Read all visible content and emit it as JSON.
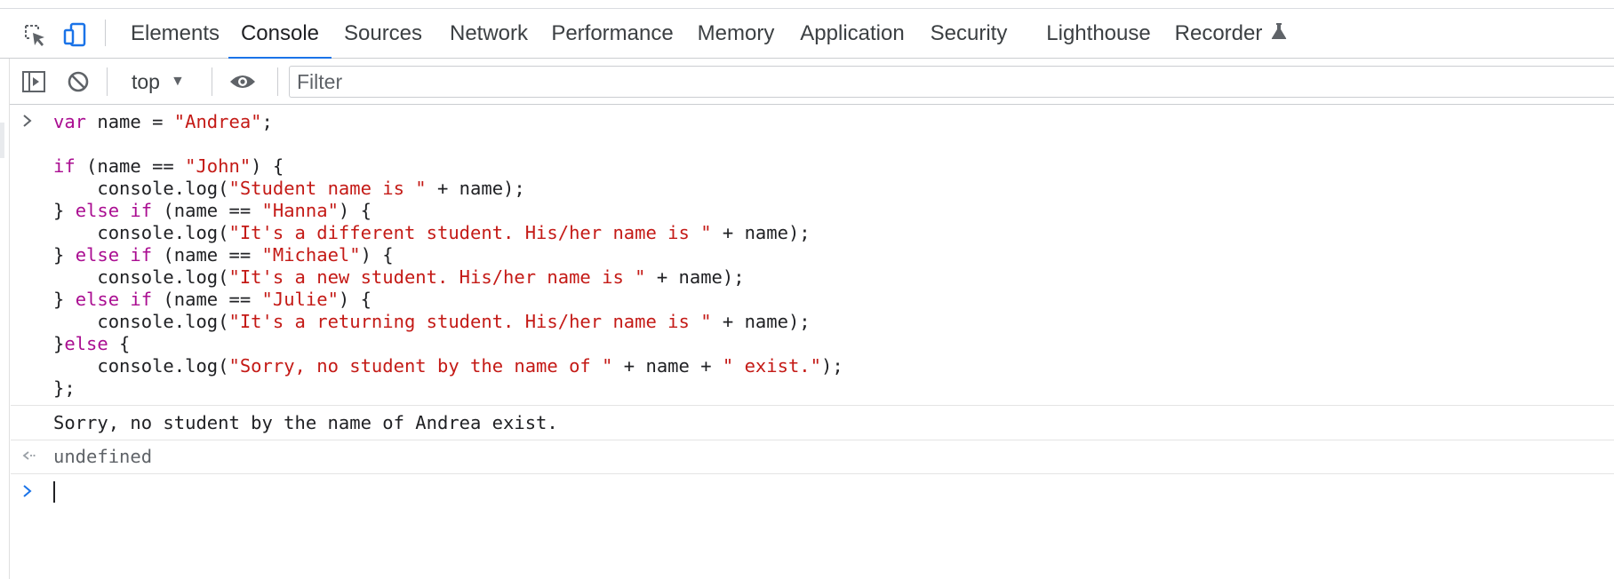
{
  "tabs": [
    "Elements",
    "Console",
    "Sources",
    "Network",
    "Performance",
    "Memory",
    "Application",
    "Security",
    "Lighthouse",
    "Recorder"
  ],
  "active_tab": "Console",
  "toolbar": {
    "context": "top",
    "filter_placeholder": "Filter"
  },
  "console": {
    "input_lines": [
      [
        {
          "t": "var",
          "c": "kw"
        },
        {
          "t": " name = "
        },
        {
          "t": "\"Andrea\"",
          "c": "str"
        },
        {
          "t": ";"
        }
      ],
      [],
      [
        {
          "t": "if",
          "c": "kw"
        },
        {
          "t": " (name == "
        },
        {
          "t": "\"John\"",
          "c": "str"
        },
        {
          "t": ") {"
        }
      ],
      [
        {
          "t": "    console.log("
        },
        {
          "t": "\"Student name is \"",
          "c": "str"
        },
        {
          "t": " + name);"
        }
      ],
      [
        {
          "t": "} "
        },
        {
          "t": "else if",
          "c": "kw"
        },
        {
          "t": " (name == "
        },
        {
          "t": "\"Hanna\"",
          "c": "str"
        },
        {
          "t": ") {"
        }
      ],
      [
        {
          "t": "    console.log("
        },
        {
          "t": "\"It's a different student. His/her name is \"",
          "c": "str"
        },
        {
          "t": " + name);"
        }
      ],
      [
        {
          "t": "} "
        },
        {
          "t": "else if",
          "c": "kw"
        },
        {
          "t": " (name == "
        },
        {
          "t": "\"Michael\"",
          "c": "str"
        },
        {
          "t": ") {"
        }
      ],
      [
        {
          "t": "    console.log("
        },
        {
          "t": "\"It's a new student. His/her name is \"",
          "c": "str"
        },
        {
          "t": " + name);"
        }
      ],
      [
        {
          "t": "} "
        },
        {
          "t": "else if",
          "c": "kw"
        },
        {
          "t": " (name == "
        },
        {
          "t": "\"Julie\"",
          "c": "str"
        },
        {
          "t": ") {"
        }
      ],
      [
        {
          "t": "    console.log("
        },
        {
          "t": "\"It's a returning student. His/her name is \"",
          "c": "str"
        },
        {
          "t": " + name);"
        }
      ],
      [
        {
          "t": "}"
        },
        {
          "t": "else",
          "c": "kw"
        },
        {
          "t": " {"
        }
      ],
      [
        {
          "t": "    console.log("
        },
        {
          "t": "\"Sorry, no student by the name of \"",
          "c": "str"
        },
        {
          "t": " + name + "
        },
        {
          "t": "\" exist.\"",
          "c": "str"
        },
        {
          "t": ");"
        }
      ],
      [
        {
          "t": "};"
        }
      ]
    ],
    "log_output": "Sorry, no student by the name of Andrea exist.",
    "return_value": "undefined"
  },
  "icons": {
    "inspect": "inspect-element-icon",
    "device": "device-toolbar-icon",
    "sidebar": "show-sidebar-icon",
    "clear": "clear-console-icon",
    "eye": "live-expression-icon",
    "flask": "experimental-flask-icon"
  },
  "colors": {
    "accent": "#1a73e8",
    "keyword": "#aa0d91",
    "string": "#c41a16"
  }
}
